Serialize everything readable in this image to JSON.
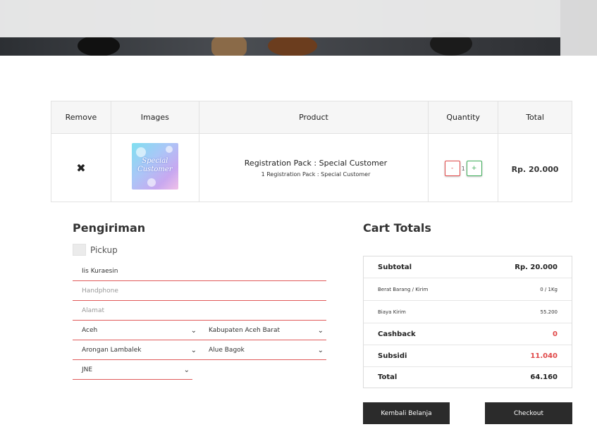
{
  "colors": {
    "accent_red": "#e04848",
    "accent_green": "#3fae5a",
    "dark_button": "#2b2b2b"
  },
  "table": {
    "headers": [
      "Remove",
      "Images",
      "Product",
      "Quantity",
      "Total"
    ],
    "row": {
      "remove_icon": "close-icon",
      "remove_glyph": "✖",
      "image_text_1": "Special",
      "image_text_2": "Customer",
      "product_name": "Registration Pack : Special Customer",
      "product_desc": "1 Registration Pack : Special Customer",
      "qty_minus": "-",
      "qty_value": "1",
      "qty_plus": "+",
      "total": "Rp. 20.000"
    }
  },
  "shipping": {
    "title": "Pengiriman",
    "pickup_label": "Pickup",
    "name_value": "Iis Kuraesin",
    "phone_placeholder": "Handphone",
    "address_placeholder": "Alamat",
    "province": "Aceh",
    "regency": "Kabupaten Aceh Barat",
    "district": "Arongan Lambalek",
    "village": "Alue Bagok",
    "courier": "JNE",
    "chevron": "⌄"
  },
  "totals": {
    "title": "Cart Totals",
    "rows": [
      {
        "label": "Subtotal",
        "value": "Rp. 20.000"
      },
      {
        "label": "Berat Barang / Kirim",
        "value": "0 / 1Kg"
      },
      {
        "label": "Biaya Kirim",
        "value": "55.200"
      },
      {
        "label": "Cashback",
        "value": "0"
      },
      {
        "label": "Subsidi",
        "value": "11.040"
      },
      {
        "label": "Total",
        "value": "64.160"
      }
    ]
  },
  "buttons": {
    "back": "Kembali Belanja",
    "checkout": "Checkout"
  }
}
